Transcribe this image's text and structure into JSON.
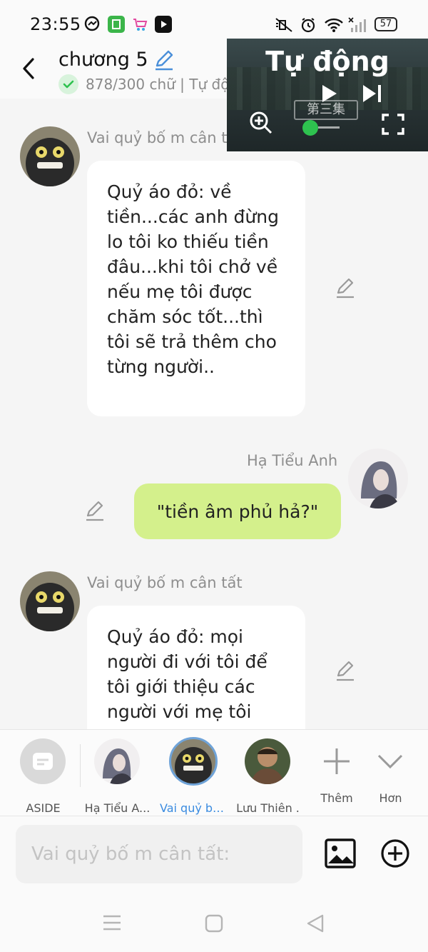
{
  "status_bar": {
    "time": "23:55",
    "battery": "57",
    "icons": [
      "messenger-icon",
      "shop-icon",
      "cart-icon",
      "video-app-icon",
      "mute-icon",
      "alarm-icon",
      "wifi-icon",
      "signal-icon"
    ]
  },
  "header": {
    "title": "chương 5",
    "subtitle": "878/300 chữ | Tự độ"
  },
  "video_overlay": {
    "title": "Tự động",
    "chinese_text": "第三集"
  },
  "messages": [
    {
      "sender": "Vai quỷ bố m cân t",
      "side": "left",
      "text": "Quỷ áo đỏ: về tiền...các anh đừng lo tôi ko thiếu tiền đâu...khi tôi chở về nếu mẹ tôi được chăm sóc tốt...thì tôi sẽ trả thêm cho từng người.."
    },
    {
      "sender": "Hạ Tiểu Anh",
      "side": "right",
      "text": "\"tiền âm phủ hả?\""
    },
    {
      "sender": "Vai quỷ bố m cân tất",
      "side": "left",
      "text": "Quỷ áo đỏ: mọi người đi với tôi để tôi giới thiệu các người với mẹ tôi"
    }
  ],
  "character_bar": {
    "items": [
      {
        "label": "ASIDE"
      },
      {
        "label": "Hạ Tiểu A..."
      },
      {
        "label": "Vai quỷ bố..."
      },
      {
        "label": "Lưu Thiên ."
      },
      {
        "label": "Thêm"
      },
      {
        "label": "Hơn"
      }
    ],
    "active_color": "#3a8be0"
  },
  "input": {
    "placeholder": "Vai quỷ bố m cân tất:"
  },
  "colors": {
    "my_bubble": "#d4f08c",
    "other_bubble": "#ffffff",
    "background": "#f5f5f5",
    "check_green": "#2ec24f"
  }
}
